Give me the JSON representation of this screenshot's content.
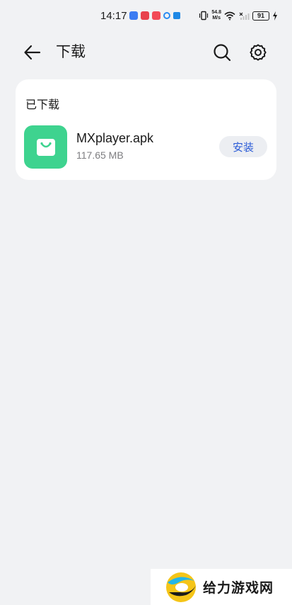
{
  "status_bar": {
    "time": "14:17",
    "net_speed_value": "54.8",
    "net_speed_unit": "M/s",
    "battery_level": "91"
  },
  "header": {
    "title": "下载",
    "back_icon": "back-arrow-icon",
    "search_icon": "search-icon",
    "settings_icon": "gear-icon"
  },
  "downloads": {
    "section_label": "已下载",
    "items": [
      {
        "file_name": "MXplayer.apk",
        "file_size": "117.65 MB",
        "action_label": "安装",
        "icon": "shopping-bag-icon",
        "icon_color": "#3ed38f"
      }
    ]
  },
  "watermark": {
    "text": "给力游戏网"
  },
  "colors": {
    "background": "#f1f2f4",
    "card": "#ffffff",
    "accent": "#2a5bd7",
    "secondary_text": "#7d7d80"
  }
}
